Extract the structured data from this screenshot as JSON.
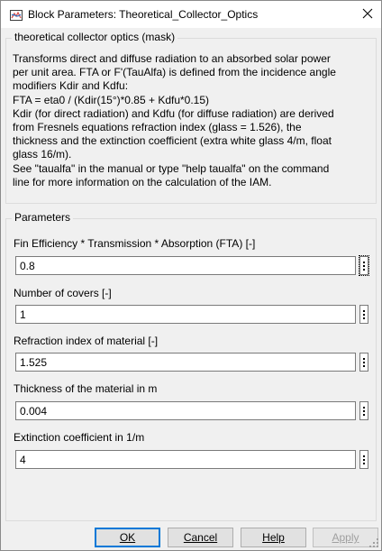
{
  "window": {
    "title": "Block Parameters: Theoretical_Collector_Optics",
    "icons": {
      "app": "simulink-block-icon",
      "close": "close-icon",
      "grip": "resize-grip-icon"
    }
  },
  "mask": {
    "group_title": "theoretical collector optics (mask)",
    "description": "Transforms direct and diffuse radiation to an absorbed solar power\nper unit area. FTA or F'(TauAlfa) is defined from the incidence angle\nmodifiers Kdir and Kdfu:\nFTA = eta0 / (Kdir(15°)*0.85 + Kdfu*0.15)\nKdir (for direct radiation) and Kdfu (for diffuse radiation) are derived\nfrom Fresnels equations refraction index (glass = 1.526), the\nthickness and the extinction coefficient (extra white glass 4/m, float\nglass 16/m).\nSee \"taualfa\" in the manual or type \"help taualfa\" on the command\nline for more information on the calculation of the IAM."
  },
  "parameters": {
    "group_title": "Parameters",
    "items": [
      {
        "label": "Fin Efficiency * Transmission * Absorption (FTA) [-]",
        "value": "0.8"
      },
      {
        "label": "Number of covers [-]",
        "value": "1"
      },
      {
        "label": "Refraction index of material [-]",
        "value": "1.525"
      },
      {
        "label": "Thickness of the material in m",
        "value": "0.004"
      },
      {
        "label": "Extinction coefficient in 1/m",
        "value": "4"
      }
    ]
  },
  "buttons": {
    "ok": "OK",
    "cancel": "Cancel",
    "help": "Help",
    "apply": "Apply"
  },
  "colors": {
    "accent": "#0078d7",
    "background": "#f0f0f0",
    "disabled_text": "#a0a0a0"
  }
}
